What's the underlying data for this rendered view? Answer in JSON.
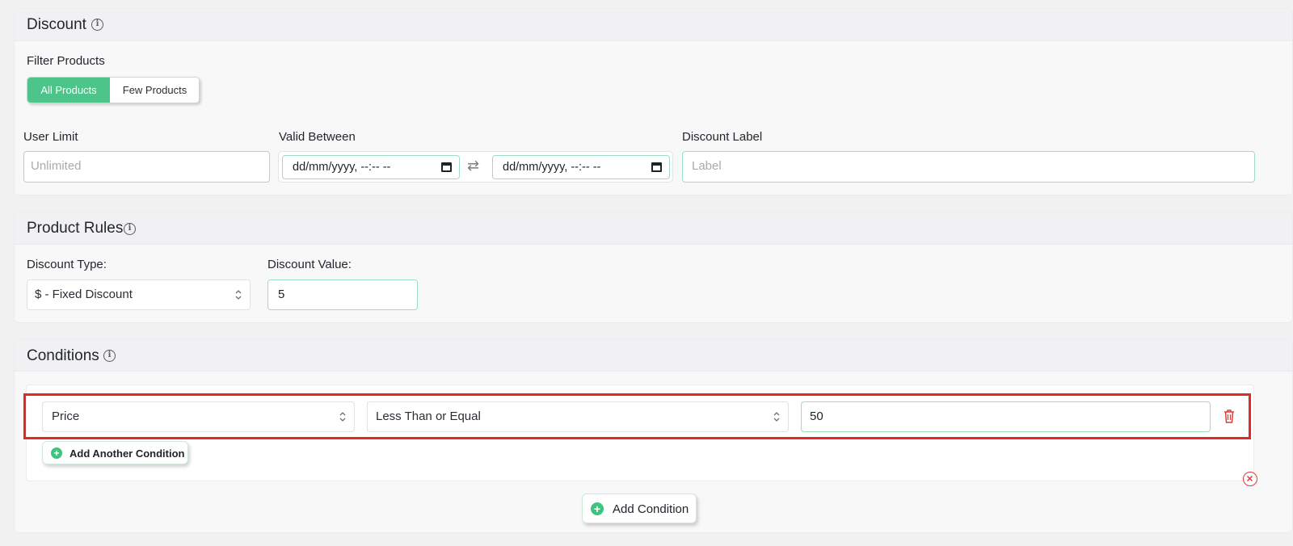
{
  "discount": {
    "title": "Discount",
    "filter_label": "Filter Products",
    "filter_options": [
      "All Products",
      "Few Products"
    ],
    "filter_selected": "All Products",
    "user_limit_label": "User Limit",
    "user_limit_placeholder": "Unlimited",
    "valid_between_label": "Valid Between",
    "valid_from_placeholder": "dd/mm/yyyy, --:-- --",
    "valid_to_placeholder": "dd/mm/yyyy, --:-- --",
    "discount_label_label": "Discount Label",
    "discount_label_placeholder": "Label"
  },
  "product_rules": {
    "title": "Product Rules",
    "discount_type_label": "Discount Type:",
    "discount_type_value": "$ - Fixed Discount",
    "discount_value_label": "Discount Value:",
    "discount_value": "5"
  },
  "conditions": {
    "title": "Conditions",
    "rows": [
      {
        "field": "Price",
        "operator": "Less Than or Equal",
        "value": "50"
      }
    ],
    "add_another_label": "Add Another Condition",
    "add_condition_label": "Add Condition"
  },
  "colors": {
    "accent": "#4cc48a",
    "highlight": "#e12a26",
    "danger": "#e03a3a"
  },
  "icons": [
    "info-icon",
    "calendar-icon",
    "swap-icon",
    "up-down-icon",
    "trash-icon",
    "plus-circle-icon",
    "close-circle-icon"
  ]
}
